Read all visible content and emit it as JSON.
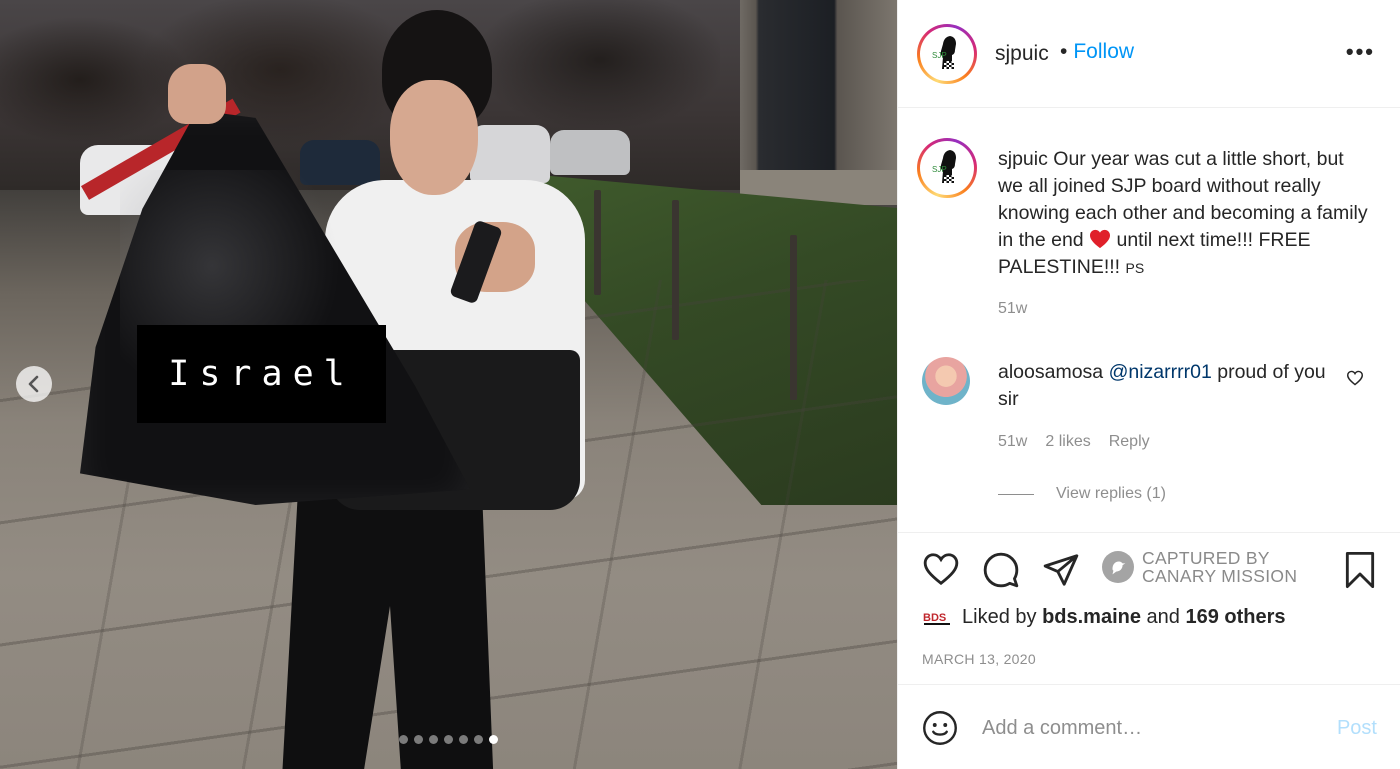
{
  "photo": {
    "overlay_label": "Israel",
    "carousel_total": 7,
    "carousel_active": 7
  },
  "header": {
    "username": "sjpuic",
    "separator": "•",
    "follow_label": "Follow",
    "more_label": "•••"
  },
  "avatar": {
    "logo_text": "SJP"
  },
  "caption": {
    "username": "sjpuic",
    "text_before_heart": " Our year was cut a little short, but we all joined SJP board without really knowing each other and becoming a family in the end ",
    "text_after_heart": " until next time!!! FREE PALESTINE!!! ",
    "ps": "PS",
    "time": "51w"
  },
  "comment": {
    "username": "aloosamosa",
    "mention": "@nizarrrr01",
    "text": " proud of you sir",
    "time": "51w",
    "likes": "2 likes",
    "reply_label": "Reply",
    "view_replies": "View replies (1)"
  },
  "actions": {
    "captured_line1": "CAPTURED BY",
    "captured_line2": "CANARY MISSION"
  },
  "likes": {
    "logo_text": "BDS",
    "prefix": "Liked by ",
    "user": "bds.maine",
    "middle": " and ",
    "others": "169 others"
  },
  "date": "MARCH 13, 2020",
  "add_comment": {
    "placeholder": "Add a comment…",
    "post_label": "Post"
  },
  "colors": {
    "accent": "#0095f6",
    "post_disabled": "#b2dffc",
    "heart": "#ed4956"
  }
}
